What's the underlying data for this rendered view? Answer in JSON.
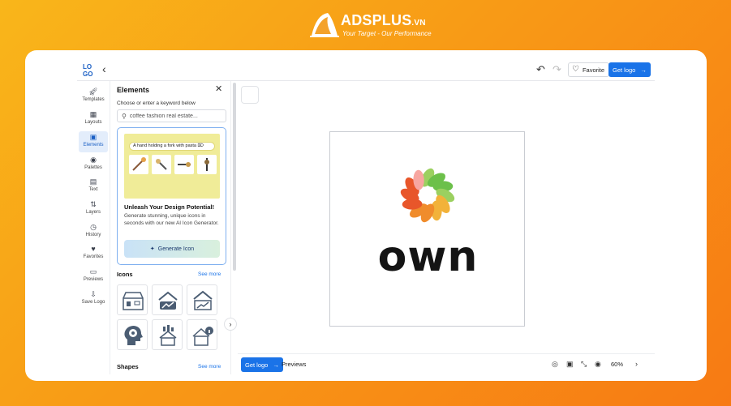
{
  "watermark": {
    "brand": "ADSPLUS",
    "domain": ".VN",
    "tagline": "Your Target - Our Performance"
  },
  "topbar": {
    "logo_text": "LOGO",
    "back_icon": "chevron-left-icon",
    "undo_icon": "undo-icon",
    "redo_icon": "redo-icon",
    "favorite_label": "Favorite",
    "get_logo_label": "Get logo"
  },
  "nav": {
    "items": [
      {
        "label": "Templates",
        "icon": "rocket-icon"
      },
      {
        "label": "Layouts",
        "icon": "layouts-icon"
      },
      {
        "label": "Elements",
        "icon": "image-icon",
        "active": true
      },
      {
        "label": "Palettes",
        "icon": "palette-icon"
      },
      {
        "label": "Text",
        "icon": "text-icon"
      },
      {
        "label": "Layers",
        "icon": "layers-icon"
      },
      {
        "label": "History",
        "icon": "clock-icon"
      },
      {
        "label": "Favorites",
        "icon": "heart-icon"
      },
      {
        "label": "Previews",
        "icon": "monitor-icon"
      },
      {
        "label": "Save Logo",
        "icon": "save-icon"
      }
    ]
  },
  "panel": {
    "title": "Elements",
    "subtitle": "Choose or enter a keyword below",
    "search_placeholder": "coffee fashion real estate...",
    "promo": {
      "prompt": "A hand holding a fork with pasta",
      "heading": "Unleash Your Design Potential!",
      "body": "Generate stunning, unique icons in seconds with our new AI Icon Generator.",
      "button": "Generate Icon"
    },
    "icons_title": "Icons",
    "shapes_title": "Shapes",
    "see_more": "See more"
  },
  "canvas": {
    "wordmark": "own",
    "mark_colors": [
      "#e8562a",
      "#f08c2c",
      "#f2b23a",
      "#9bd060",
      "#6cc04a",
      "#f7a6a0",
      "#f2c1c1"
    ]
  },
  "bottombar": {
    "get_logo_label": "Get logo",
    "previews_label": "Previews",
    "zoom": "60%"
  },
  "colors": {
    "accent": "#1a73e8",
    "background_orange": "#f89a16"
  }
}
